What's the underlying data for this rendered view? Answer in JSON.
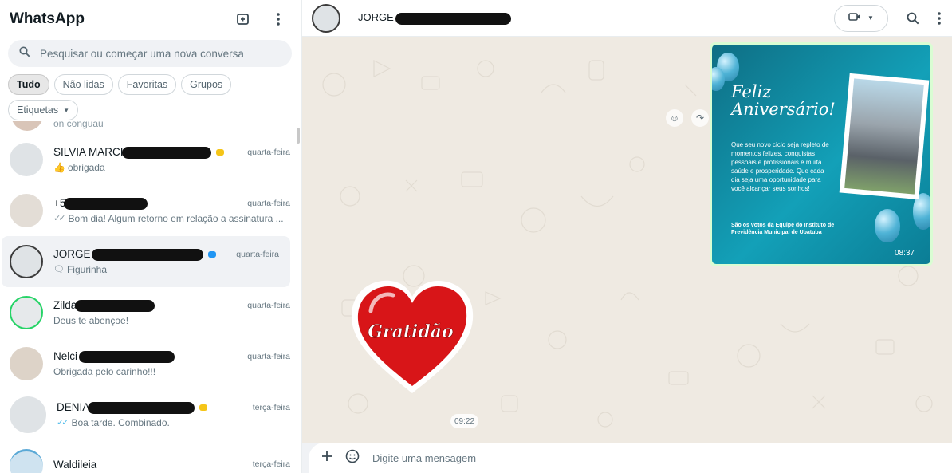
{
  "sidebar": {
    "title": "WhatsApp",
    "search_placeholder": "Pesquisar ou começar uma nova conversa",
    "filters": [
      "Tudo",
      "Não lidas",
      "Favoritas",
      "Grupos",
      "Etiquetas"
    ],
    "partial_preview": "on conguau",
    "chats": [
      {
        "name": "SILVIA MARCI",
        "time": "quarta-feira",
        "preview": "obrigada",
        "preview_prefix": "👍",
        "label_color": "#f5c518"
      },
      {
        "name": "+5",
        "time": "quarta-feira",
        "preview": "Bom dia! Algum retorno em relação a assinatura ...",
        "preview_prefix": "✓✓"
      },
      {
        "name": "JORGE",
        "time": "quarta-feira",
        "preview": "Figurinha",
        "preview_prefix": "🗨",
        "label_color": "#2196f3"
      },
      {
        "name": "Zilda",
        "time": "quarta-feira",
        "preview": "Deus te abençoe!"
      },
      {
        "name": "Nelci",
        "time": "quarta-feira",
        "preview": "Obrigada pelo carinho!!!"
      },
      {
        "name": "DENIA",
        "time": "terça-feira",
        "preview": "Boa tarde. Combinado.",
        "preview_prefix": "✓✓",
        "label_color": "#f5c518"
      },
      {
        "name": "Waldileia",
        "time": "terça-feira",
        "preview": ""
      }
    ]
  },
  "chat": {
    "contact_name": "JORGE",
    "image_message": {
      "script_line1": "Feliz",
      "script_line2": "Aniversário!",
      "body": "Que seu novo ciclo seja repleto de momentos felizes, conquistas pessoais e profissionais e muita saúde e prosperidade. Que cada dia seja uma oportunidade para você alcançar seus sonhos!",
      "footer": "São os votos da Equipe do Instituto de Previdência Municipal de Ubatuba",
      "time": "08:37"
    },
    "sticker": {
      "text": "Gratidão",
      "time": "09:22"
    },
    "composer_placeholder": "Digite uma mensagem"
  },
  "colors": {
    "accent": "#00a884",
    "bubble_out": "#d9fdd3",
    "chat_bg": "#efeae2"
  }
}
